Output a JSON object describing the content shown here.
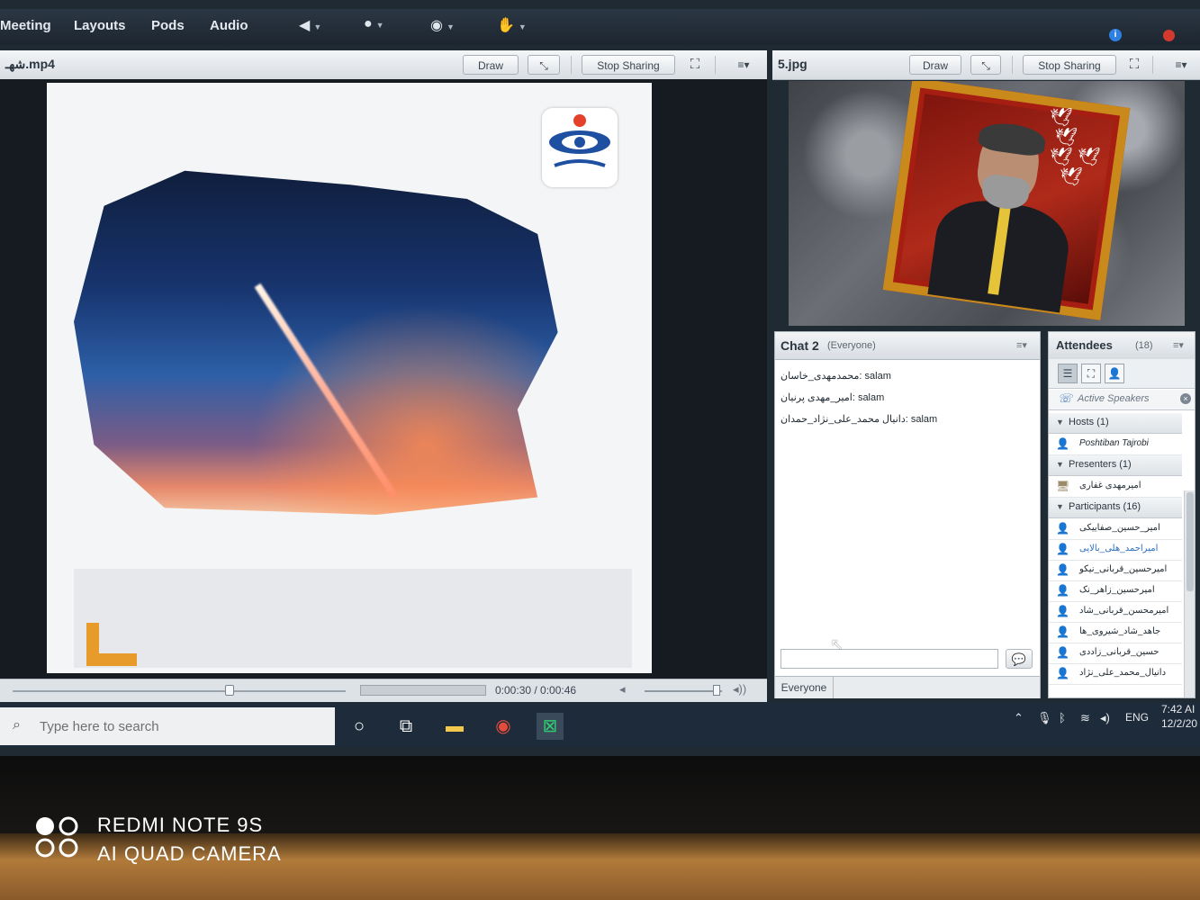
{
  "menubar": {
    "items": [
      "Meeting",
      "Layouts",
      "Pods",
      "Audio"
    ]
  },
  "share_pod_left": {
    "title": "شهـ.mp4",
    "draw_label": "Draw",
    "stop_label": "Stop Sharing",
    "time": "0:00:30 / 0:00:46",
    "progress": 0.65
  },
  "share_pod_right": {
    "title": "5.jpg",
    "draw_label": "Draw",
    "stop_label": "Stop Sharing"
  },
  "chat": {
    "title": "Chat 2",
    "scope": "(Everyone)",
    "messages": [
      {
        "sender": "محمدمهدی_خاسان:",
        "text": "salam"
      },
      {
        "sender": "امیر_مهدی پرنیان:",
        "text": "salam"
      },
      {
        "sender": "دانیال محمد_علی_نژاد_حمدان:",
        "text": "salam"
      }
    ],
    "target": "Everyone"
  },
  "attendees": {
    "title": "Attendees",
    "count": "(18)",
    "active_speakers": "Active Speakers",
    "groups": {
      "hosts": "Hosts (1)",
      "presenters": "Presenters (1)",
      "participants": "Participants (16)"
    },
    "hosts": [
      "Poshtiban Tajrobi"
    ],
    "presenters": [
      "امیرمهدی غفاری"
    ],
    "participants": [
      "امیر_حسین_صفاییکی",
      "امیراحمد_هلی_بالایی",
      "امیرحسین_قربانی_نیکو",
      "امیرحسین_زاهر_نک",
      "امیرمحسن_قربانی_شاد",
      "جاهد_شاد_شیروی_ها",
      "حسین_قربانی_زاددی",
      "دانیال_محمد_علی_نژاد"
    ]
  },
  "taskbar": {
    "search_placeholder": "Type here to search",
    "lang": "ENG",
    "time": "7:42 AI",
    "date": "12/2/20"
  },
  "watermark": {
    "line1": "REDMI NOTE 9S",
    "line2": "AI QUAD CAMERA"
  },
  "colors": {
    "accent": "#2d6dbd",
    "end_meeting": "#d33a2e",
    "frame_gold": "#c98a1b",
    "frame_red": "#a61d12"
  }
}
